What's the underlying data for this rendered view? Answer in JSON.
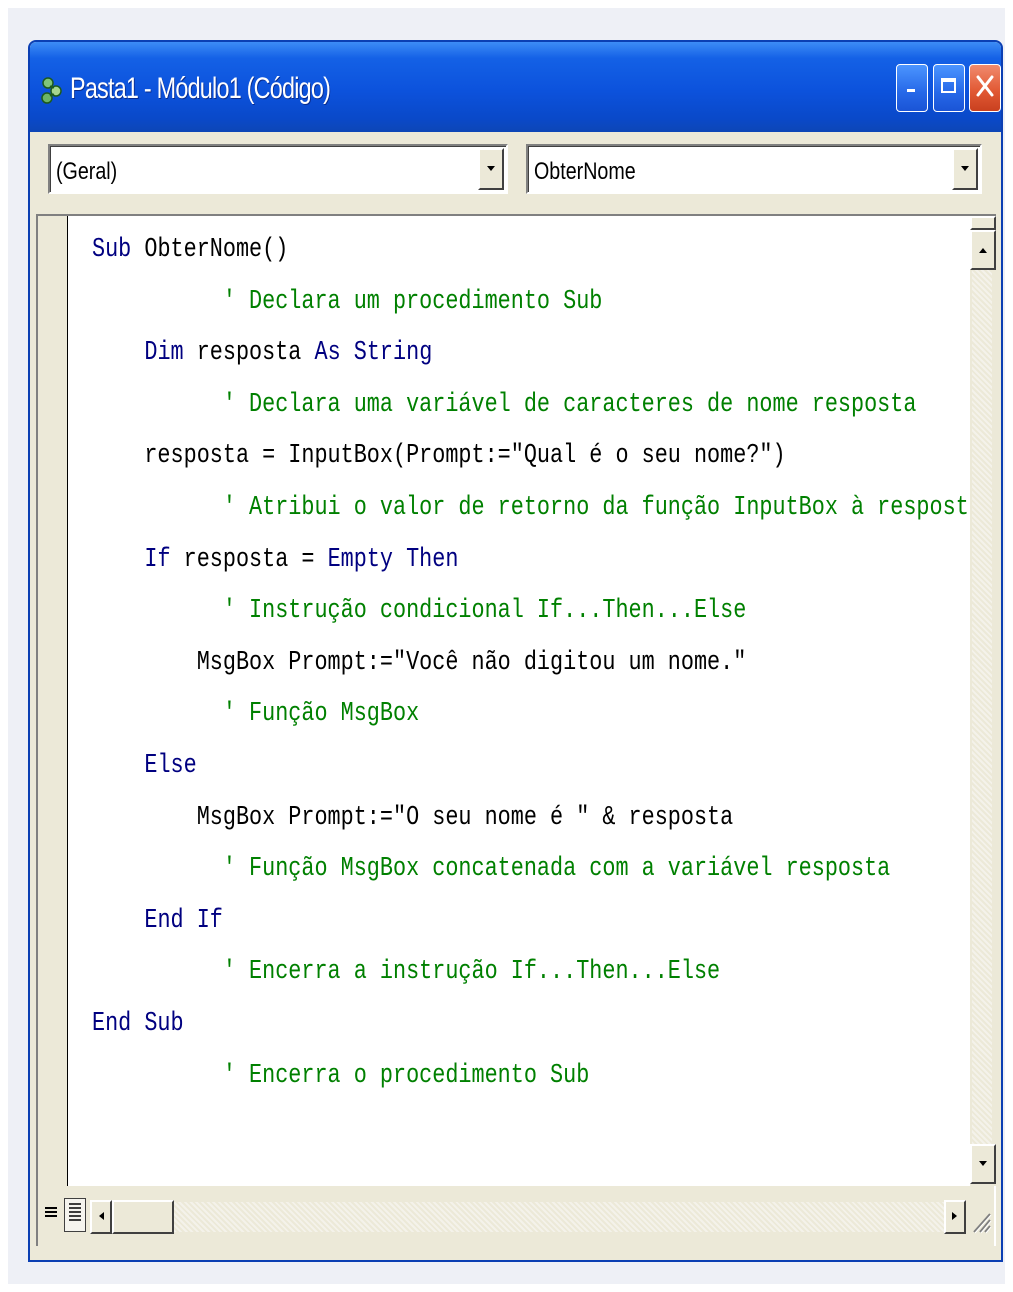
{
  "window": {
    "title": "Pasta1 - Módulo1 (Código)"
  },
  "toolbar": {
    "object_combo": "(Geral)",
    "procedure_combo": "ObterNome"
  },
  "colors": {
    "keyword": "#000080",
    "comment": "#008000",
    "text": "#000000",
    "titlebar": "#0c52dc"
  },
  "icons": {
    "app": "vba-module-icon",
    "minimize": "minimize-icon",
    "maximize": "maximize-icon",
    "close": "close-icon",
    "procedure_view": "procedure-view-icon",
    "full_module_view": "full-module-view-icon"
  },
  "code": [
    [
      {
        "t": "Sub",
        "c": "kw"
      },
      {
        "t": " ObterNome()",
        "c": "tx"
      }
    ],
    [
      {
        "t": "          ' Declara um procedimento Sub",
        "c": "cm"
      }
    ],
    [
      {
        "t": "    ",
        "c": "tx"
      },
      {
        "t": "Dim",
        "c": "kw"
      },
      {
        "t": " resposta ",
        "c": "tx"
      },
      {
        "t": "As",
        "c": "kw"
      },
      {
        "t": " ",
        "c": "tx"
      },
      {
        "t": "String",
        "c": "kw"
      }
    ],
    [
      {
        "t": "          ' Declara uma variável de caracteres de nome resposta",
        "c": "cm"
      }
    ],
    [
      {
        "t": "    resposta = InputBox(Prompt:=\"Qual é o seu nome?\")",
        "c": "tx"
      }
    ],
    [
      {
        "t": "          ' Atribui o valor de retorno da função InputBox à resposta",
        "c": "cm"
      }
    ],
    [
      {
        "t": "    ",
        "c": "tx"
      },
      {
        "t": "If",
        "c": "kw"
      },
      {
        "t": " resposta = ",
        "c": "tx"
      },
      {
        "t": "Empty",
        "c": "kw"
      },
      {
        "t": " ",
        "c": "tx"
      },
      {
        "t": "Then",
        "c": "kw"
      }
    ],
    [
      {
        "t": "          ' Instrução condicional If...Then...Else",
        "c": "cm"
      }
    ],
    [
      {
        "t": "        MsgBox Prompt:=\"Você não digitou um nome.\"",
        "c": "tx"
      }
    ],
    [
      {
        "t": "          ' Função MsgBox",
        "c": "cm"
      }
    ],
    [
      {
        "t": "    ",
        "c": "tx"
      },
      {
        "t": "Else",
        "c": "kw"
      }
    ],
    [
      {
        "t": "        MsgBox Prompt:=\"O seu nome é \" & resposta",
        "c": "tx"
      }
    ],
    [
      {
        "t": "          ' Função MsgBox concatenada com a variável resposta",
        "c": "cm"
      }
    ],
    [
      {
        "t": "    ",
        "c": "tx"
      },
      {
        "t": "End If",
        "c": "kw"
      }
    ],
    [
      {
        "t": "          ' Encerra a instrução If...Then...Else",
        "c": "cm"
      }
    ],
    [
      {
        "t": "End Sub",
        "c": "kw"
      }
    ],
    [
      {
        "t": "          ' Encerra o procedimento Sub",
        "c": "cm"
      }
    ]
  ]
}
